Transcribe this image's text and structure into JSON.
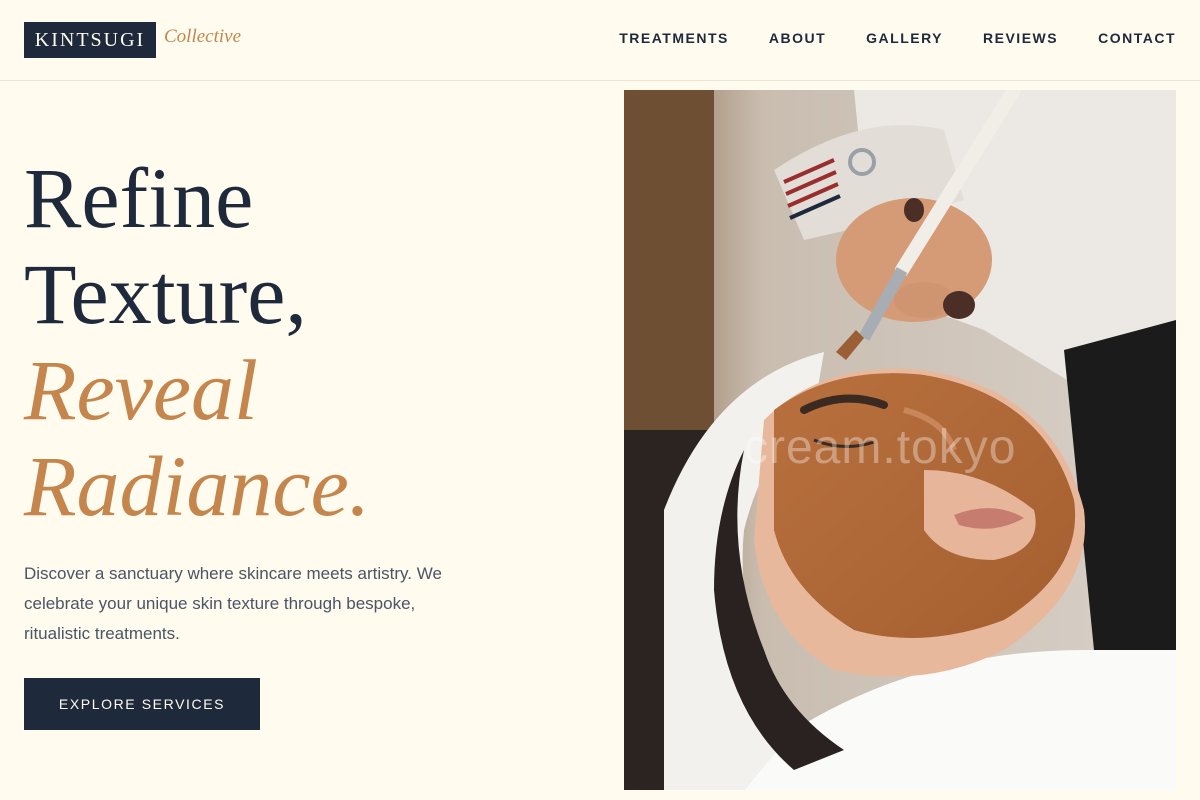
{
  "brand": {
    "name": "KINTSUGI",
    "tagline": "Collective"
  },
  "nav": {
    "items": [
      {
        "label": "TREATMENTS"
      },
      {
        "label": "ABOUT"
      },
      {
        "label": "GALLERY"
      },
      {
        "label": "REVIEWS"
      },
      {
        "label": "CONTACT"
      }
    ]
  },
  "hero": {
    "headline": {
      "line1": "Refine",
      "line2": "Texture,",
      "line3": "Reveal",
      "line4": "Radiance."
    },
    "description": "Discover a sanctuary where skincare meets artistry. We celebrate your unique skin texture through bespoke, ritualistic treatments.",
    "cta_label": "EXPLORE SERVICES",
    "image": {
      "alt": "Facial treatment with clay mask being applied by brush",
      "watermark": "cream.tokyo"
    }
  },
  "colors": {
    "background": "#fffbee",
    "navy": "#1e293b",
    "accent": "#c4864c",
    "body_text": "#4a5566"
  }
}
